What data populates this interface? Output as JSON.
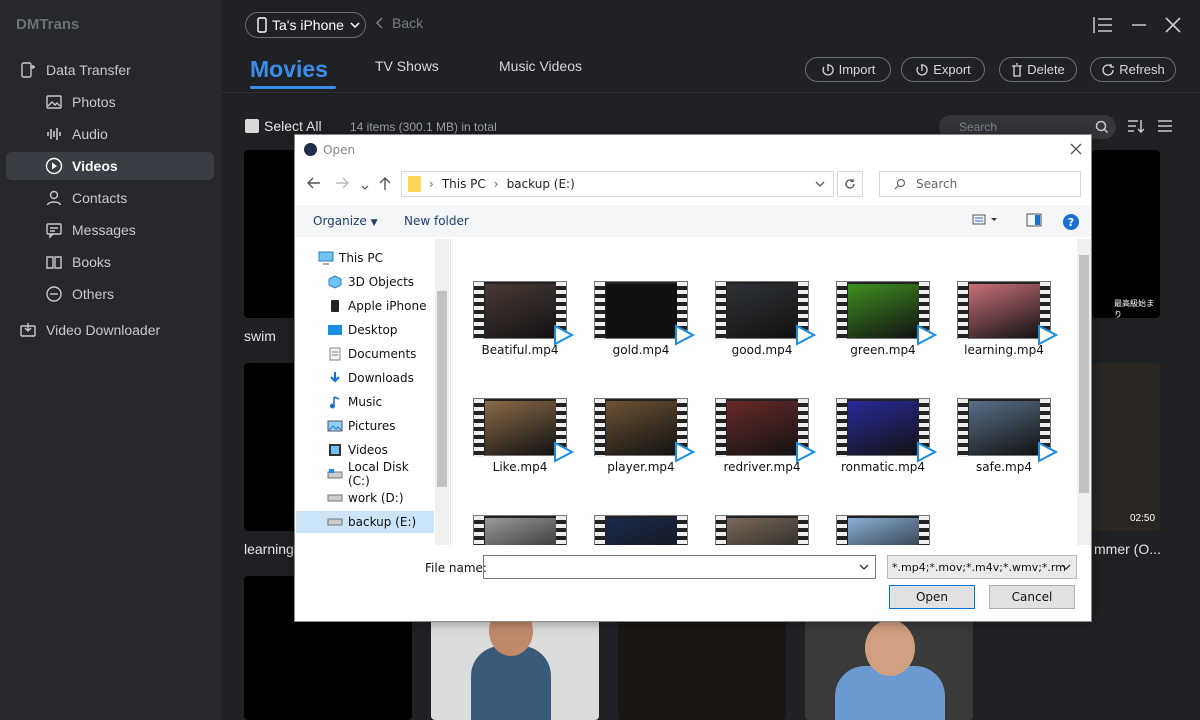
{
  "app": {
    "title": "DMTrans",
    "nav": {
      "data_transfer": "Data Transfer",
      "photos": "Photos",
      "audio": "Audio",
      "videos": "Videos",
      "contacts": "Contacts",
      "messages": "Messages",
      "books": "Books",
      "others": "Others",
      "video_downloader": "Video Downloader"
    }
  },
  "header": {
    "device": "Ta's iPhone",
    "back": "Back",
    "tabs": [
      "Movies",
      "TV Shows",
      "Music Videos"
    ],
    "actions": {
      "import": "Import",
      "export": "Export",
      "delete": "Delete",
      "refresh": "Refresh"
    }
  },
  "toolbar": {
    "select_all": "Select All",
    "count": "14 items (300.1 MB) in total",
    "search_placeholder": "Search"
  },
  "thumbnails": {
    "label_1": "swim",
    "label_2": "learning",
    "label_3": "mmer (O...",
    "duration": "02:50",
    "overlay_text": "最高級始まり"
  },
  "dialog": {
    "title": "Open",
    "path": [
      "This PC",
      "backup (E:)"
    ],
    "search_placeholder": "Search",
    "organize": "Organize",
    "new_folder": "New folder",
    "help": "?",
    "tree": [
      {
        "label": "This PC",
        "icon": "pc-icon"
      },
      {
        "label": "3D Objects",
        "icon": "cube-icon"
      },
      {
        "label": "Apple iPhone",
        "icon": "phone-icon"
      },
      {
        "label": "Desktop",
        "icon": "desktop-icon"
      },
      {
        "label": "Documents",
        "icon": "document-icon"
      },
      {
        "label": "Downloads",
        "icon": "download-icon"
      },
      {
        "label": "Music",
        "icon": "music-icon"
      },
      {
        "label": "Pictures",
        "icon": "pictures-icon"
      },
      {
        "label": "Videos",
        "icon": "videos-icon"
      },
      {
        "label": "Local Disk (C:)",
        "icon": "disk-icon"
      },
      {
        "label": "work (D:)",
        "icon": "drive-icon"
      },
      {
        "label": "backup (E:)",
        "icon": "drive-icon"
      }
    ],
    "files": [
      {
        "name": "Beatiful.mp4",
        "color": "#4a3a36"
      },
      {
        "name": "gold.mp4",
        "color": "#111111"
      },
      {
        "name": "good.mp4",
        "color": "#2e3236"
      },
      {
        "name": "green.mp4",
        "color": "#3f8f22"
      },
      {
        "name": "learning.mp4",
        "color": "#c9707a"
      },
      {
        "name": "Like.mp4",
        "color": "#8a6a48"
      },
      {
        "name": "player.mp4",
        "color": "#6b5234"
      },
      {
        "name": "redriver.mp4",
        "color": "#6a2a2a"
      },
      {
        "name": "ronmatic.mp4",
        "color": "#2a2a9a"
      },
      {
        "name": "safe.mp4",
        "color": "#5a6f88"
      },
      {
        "name": "",
        "color": "#9a9a9a"
      },
      {
        "name": "",
        "color": "#1a2a4a"
      },
      {
        "name": "",
        "color": "#7a6a5a"
      },
      {
        "name": "",
        "color": "#8ab0d8"
      }
    ],
    "file_name_label": "File name:",
    "file_name_value": "",
    "filter": "*.mp4;*.mov;*.m4v;*.wmv;*.rm",
    "open_btn": "Open",
    "cancel_btn": "Cancel"
  },
  "colors": {
    "accent": "#3a8eea",
    "sidebar": "#26282c",
    "background": "#1f2125"
  }
}
